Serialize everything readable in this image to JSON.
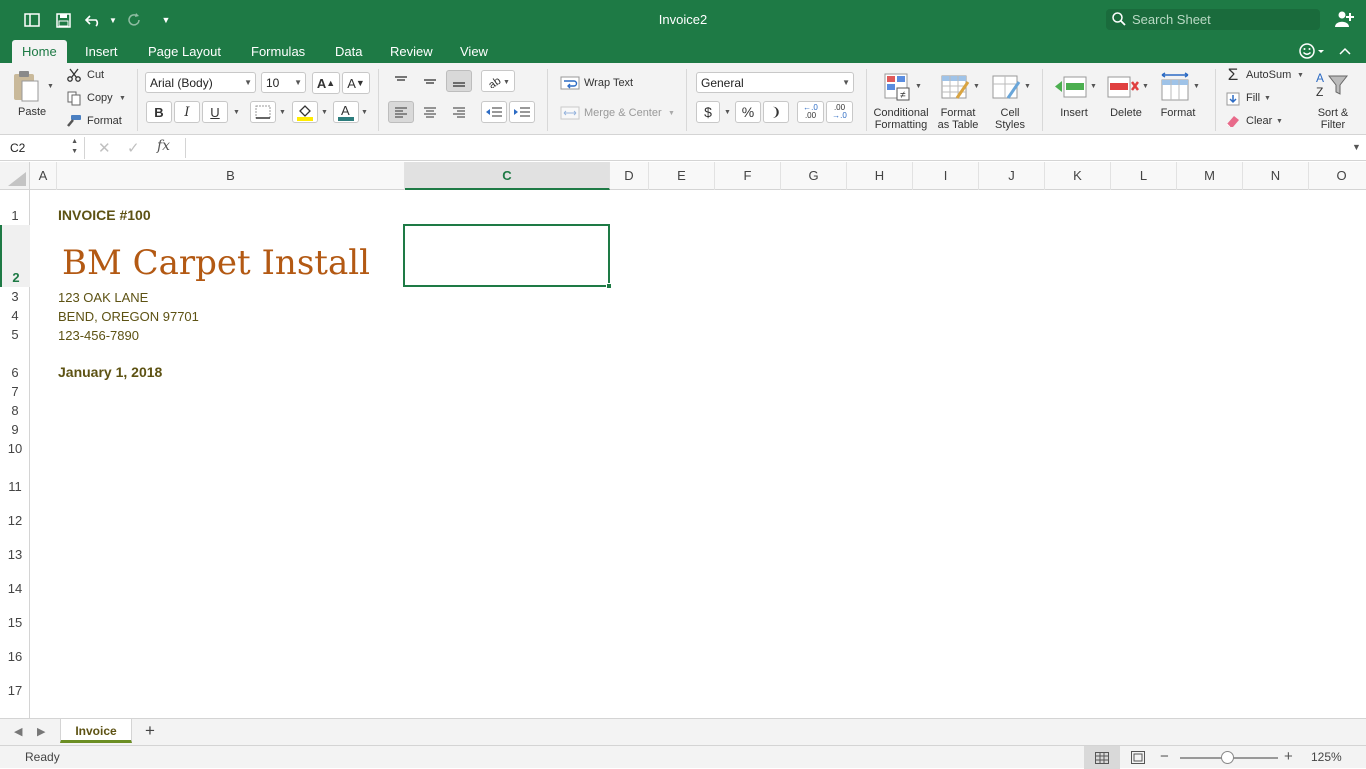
{
  "window": {
    "title": "Invoice2"
  },
  "search": {
    "placeholder": "Search Sheet"
  },
  "tabs": [
    "Home",
    "Insert",
    "Page Layout",
    "Formulas",
    "Data",
    "Review",
    "View"
  ],
  "clipboard": {
    "paste": "Paste",
    "cut": "Cut",
    "copy": "Copy",
    "format": "Format"
  },
  "font": {
    "name": "Arial (Body)",
    "size": "10",
    "bold": "B",
    "italic": "I",
    "underline": "U"
  },
  "alignment": {
    "wrap_text": "Wrap Text",
    "merge_center": "Merge & Center"
  },
  "number": {
    "format": "General",
    "currency": "$",
    "percent": "%",
    "comma": "❩",
    "inc_dec_top": "←.0",
    "inc_dec_bottom": ".00",
    "dec_dec_top": ".00",
    "dec_dec_bottom": "→.0"
  },
  "styles": {
    "conditional": [
      "Conditional",
      "Formatting"
    ],
    "format_table": [
      "Format",
      "as Table"
    ],
    "cell_styles": [
      "Cell",
      "Styles"
    ]
  },
  "cells_group": {
    "insert": "Insert",
    "delete": "Delete",
    "format": "Format"
  },
  "editing": {
    "autosum": "AutoSum",
    "fill": "Fill",
    "clear": "Clear",
    "sort_filter": [
      "Sort &",
      "Filter"
    ]
  },
  "formula_bar": {
    "name_box": "C2",
    "fx": "fx",
    "formula": ""
  },
  "columns": [
    "A",
    "B",
    "C",
    "D",
    "E",
    "F",
    "G",
    "H",
    "I",
    "J",
    "K",
    "L",
    "M",
    "N",
    "O"
  ],
  "selected_column": "C",
  "rows": [
    "1",
    "2",
    "3",
    "4",
    "5",
    "6",
    "7",
    "8",
    "9",
    "10",
    "11",
    "12",
    "13",
    "14",
    "15",
    "16",
    "17"
  ],
  "selected_row": "2",
  "cells": {
    "B1": "INVOICE #100",
    "B2": "BM Carpet Install",
    "B3": "123 OAK LANE",
    "B4": "BEND, OREGON 97701",
    "B5": "123-456-7890",
    "B6": "January 1, 2018"
  },
  "sheets": {
    "active": "Invoice"
  },
  "status": {
    "text": "Ready",
    "zoom": "125%",
    "zoom_fraction": 0.48
  },
  "colors": {
    "accent": "#1e7a45",
    "brand_text": "#b35913",
    "olive_text": "#5d5213"
  }
}
